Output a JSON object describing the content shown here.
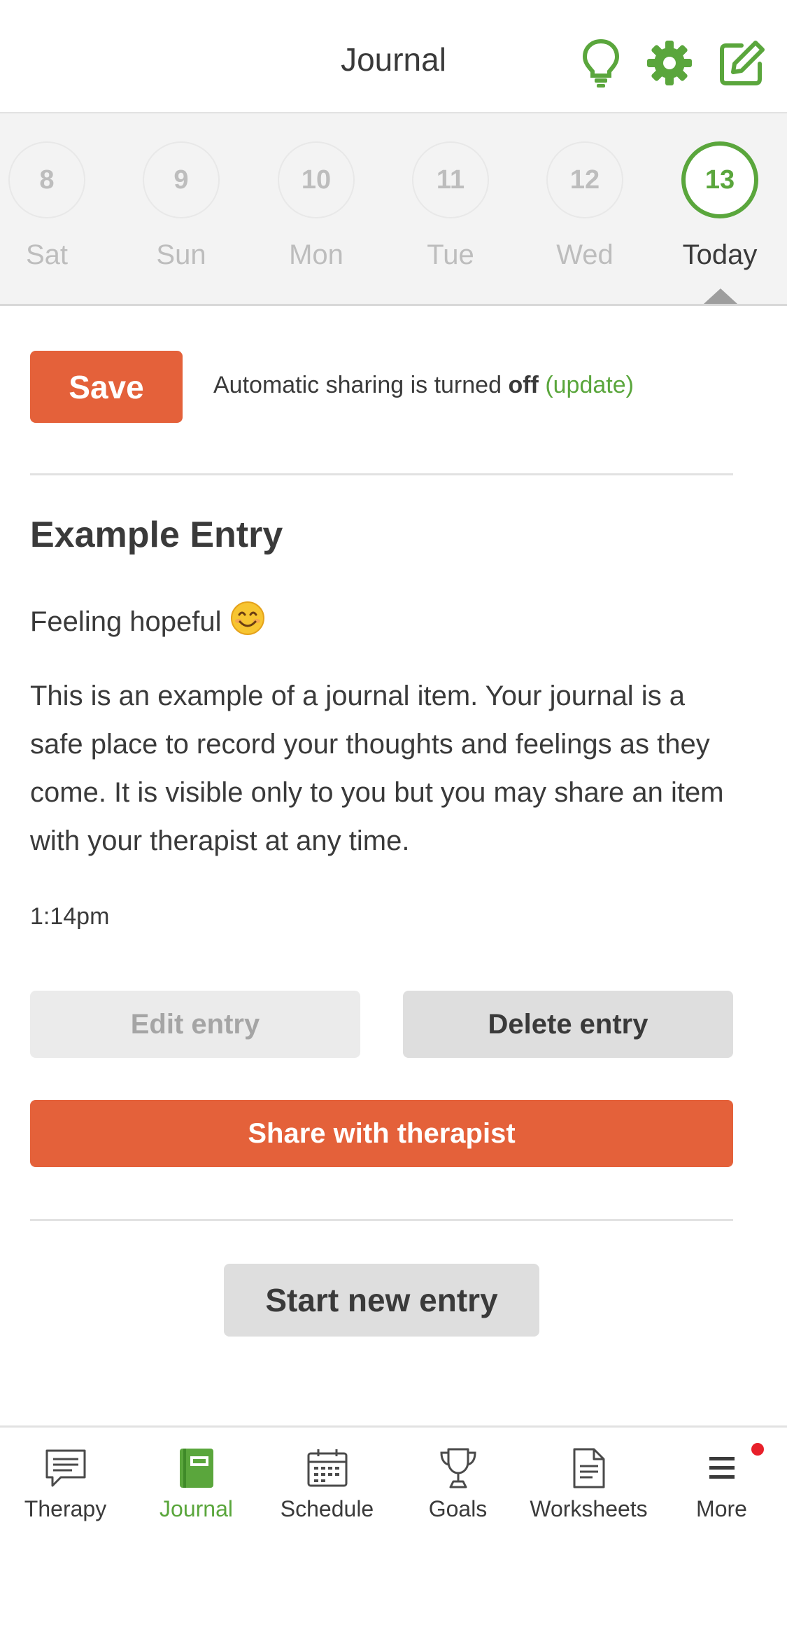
{
  "header": {
    "title": "Journal"
  },
  "icons": {
    "tips": "lightbulb-icon",
    "settings": "gear-icon",
    "new_entry": "edit-icon"
  },
  "colors": {
    "accent_green": "#5aa63c",
    "accent_orange": "#e4613a"
  },
  "days": [
    {
      "num": "8",
      "name": "Sat"
    },
    {
      "num": "9",
      "name": "Sun"
    },
    {
      "num": "10",
      "name": "Mon"
    },
    {
      "num": "11",
      "name": "Tue"
    },
    {
      "num": "12",
      "name": "Wed"
    },
    {
      "num": "13",
      "name": "Today"
    }
  ],
  "actions": {
    "save_label": "Save",
    "sharing_prefix": "Automatic sharing is turned",
    "sharing_state": "off",
    "sharing_link": "(update)"
  },
  "entry": {
    "title": "Example Entry",
    "mood": "Feeling hopeful",
    "mood_emoji": "😊",
    "body": "This is an example of a journal item. Your journal is a safe place to record your thoughts and feelings as they come. It is visible only to you but you may share an item with your therapist at any time.",
    "time": "1:14pm",
    "edit_label": "Edit entry",
    "delete_label": "Delete entry",
    "share_label": "Share with therapist"
  },
  "new_entry_label": "Start new entry",
  "tabs": [
    {
      "label": "Therapy",
      "icon": "chat-icon"
    },
    {
      "label": "Journal",
      "icon": "journal-icon"
    },
    {
      "label": "Schedule",
      "icon": "calendar-icon"
    },
    {
      "label": "Goals",
      "icon": "trophy-icon"
    },
    {
      "label": "Worksheets",
      "icon": "document-icon"
    },
    {
      "label": "More",
      "icon": "menu-icon"
    }
  ]
}
